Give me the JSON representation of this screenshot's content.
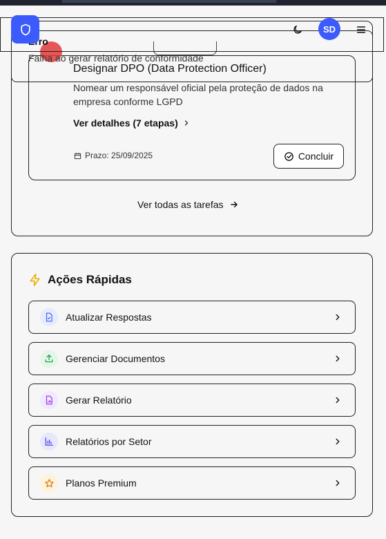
{
  "header": {
    "avatar_initials": "SD",
    "icons": [
      "shield-icon",
      "moon-icon",
      "menu-icon"
    ],
    "brand_color": "#3b5bfd"
  },
  "toast": {
    "title": "Erro",
    "message": "Falha ao gerar relatório de conformidade"
  },
  "task": {
    "title": "Designar DPO (Data Protection Officer)",
    "description": "Nomear um responsável oficial pela proteção de dados na empresa conforme LGPD",
    "details_link": "Ver detalhes (7 etapas)",
    "deadline": "Prazo: 25/09/2025",
    "complete_button": "Concluir"
  },
  "tasks_footer": {
    "view_all": "Ver todas as tarefas"
  },
  "quick_actions": {
    "title": "Ações Rápidas",
    "items": [
      {
        "label": "Atualizar Respostas",
        "icon": "file-check-icon",
        "color": "#3b5bfd",
        "bg": "#e6ebff"
      },
      {
        "label": "Gerenciar Documentos",
        "icon": "upload-icon",
        "color": "#16a34a",
        "bg": "#e3f6e9"
      },
      {
        "label": "Gerar Relatório",
        "icon": "file-chart-icon",
        "color": "#9333ea",
        "bg": "#f3e8ff"
      },
      {
        "label": "Relatórios por Setor",
        "icon": "bar-chart-icon",
        "color": "#4f46e5",
        "bg": "#e8e7fb"
      },
      {
        "label": "Planos Premium",
        "icon": "star-icon",
        "color": "#d97706",
        "bg": "#fdf2dc"
      }
    ]
  }
}
